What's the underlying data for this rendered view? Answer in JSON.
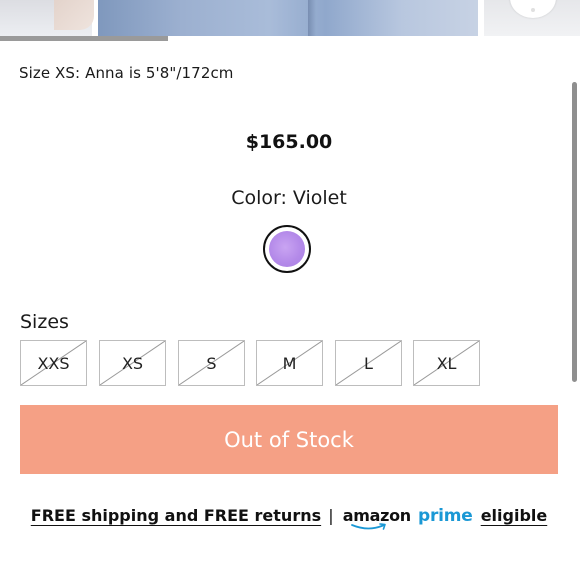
{
  "gallery": {
    "progress_fraction": 0.29
  },
  "product": {
    "model_note": "Size XS: Anna is 5'8\"/172cm",
    "price": "$165.00",
    "color_label": "Color: Violet",
    "selected_color_hex": "#b48ae9"
  },
  "sizes": {
    "label": "Sizes",
    "options": [
      "XXS",
      "XS",
      "S",
      "M",
      "L",
      "XL"
    ],
    "all_unavailable": true
  },
  "cta": {
    "label": "Out of Stock",
    "background": "#f5a085"
  },
  "shipping": {
    "free_text": "FREE shipping and FREE returns",
    "separator": "|",
    "brand": "amazon",
    "prime": "prime",
    "eligible": "eligible",
    "prime_color": "#1a98d5"
  }
}
